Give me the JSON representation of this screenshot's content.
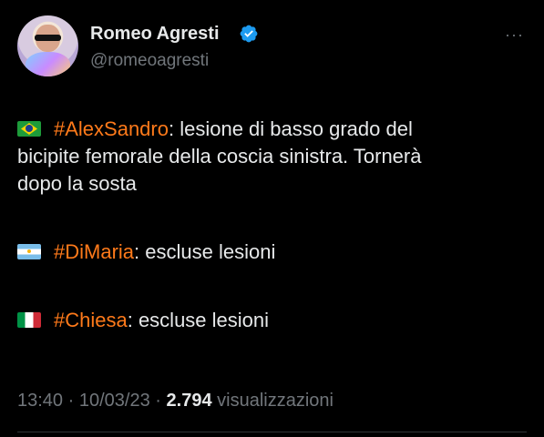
{
  "author": {
    "name": "Romeo Agresti",
    "handle": "@romeoagresti",
    "verified": true
  },
  "tweet": {
    "lines": [
      {
        "flag": "brazil-flag",
        "hashtag": "#AlexSandro",
        "text_1": ": lesione di basso grado del",
        "text_2": "bicipite femorale della coscia sinistra. Tornerà",
        "text_3": "dopo la sosta"
      },
      {
        "flag": "argentina-flag",
        "hashtag": "#DiMaria",
        "text": ": escluse lesioni"
      },
      {
        "flag": "italy-flag",
        "hashtag": "#Chiesa",
        "text": ": escluse lesioni"
      }
    ]
  },
  "meta": {
    "time": "13:40",
    "sep1": "·",
    "date": "10/03/23",
    "sep2": "·",
    "views_count": "2.794",
    "views_label": "visualizzazioni"
  },
  "more_icon": "···",
  "colors": {
    "background": "#000000",
    "text": "#e7e9ea",
    "secondary": "#71767b",
    "hashtag": "#ff7a1a",
    "verified": "#1d9bf0"
  }
}
